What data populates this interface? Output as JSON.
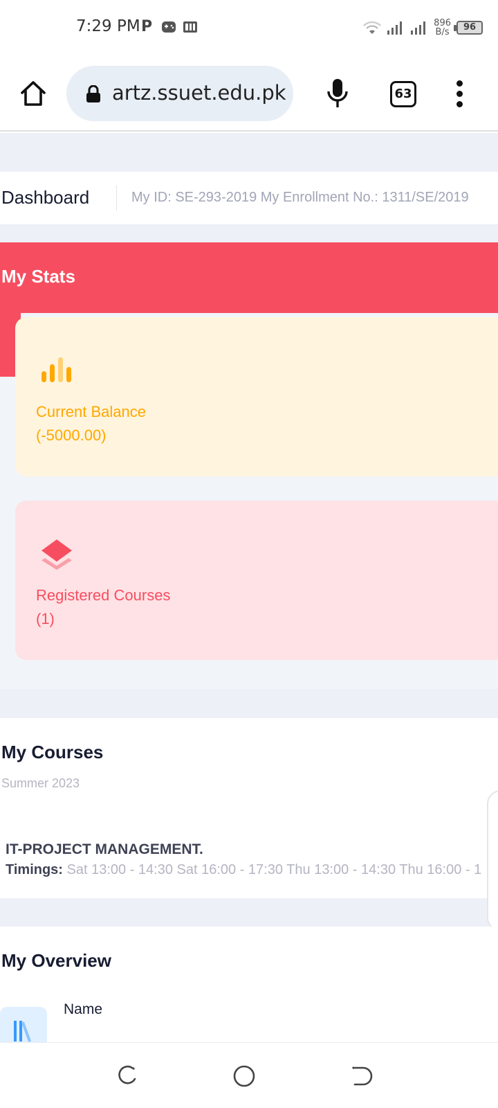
{
  "status_bar": {
    "time": "7:29 PM",
    "app_icons": [
      "p-icon",
      "game-icon",
      "pdf-icon"
    ],
    "net_speed_value": "896",
    "net_speed_unit": "B/s",
    "battery": "96"
  },
  "browser": {
    "url": "artz.ssuet.edu.pk",
    "tab_count": "63"
  },
  "subheader": {
    "title": "Dashboard",
    "info": "My ID: SE-293-2019 My Enrollment No.: 1311/SE/2019"
  },
  "stats": {
    "title": "My Stats",
    "balance": {
      "label": "Current Balance",
      "value": "(-5000.00)",
      "icon": "bar-chart-icon",
      "color": "#ffa800"
    },
    "courses": {
      "label": "Registered Courses",
      "value": "(1)",
      "icon": "layers-icon",
      "color": "#f64e60"
    },
    "header_color": "#f64e60"
  },
  "courses": {
    "title": "My Courses",
    "term": "Summer 2023",
    "items": [
      {
        "name": "IT-PROJECT MANAGEMENT.",
        "timings_label": "Timings:",
        "timings": "Sat 13:00 - 14:30 Sat 16:00 - 17:30 Thu 13:00 - 14:30 Thu 16:00 - 1"
      }
    ]
  },
  "overview": {
    "title": "My Overview",
    "first_label": "Name",
    "icon": "library-icon"
  },
  "navbar": {
    "buttons": [
      "recents-icon",
      "home-circle-icon",
      "back-icon"
    ]
  }
}
